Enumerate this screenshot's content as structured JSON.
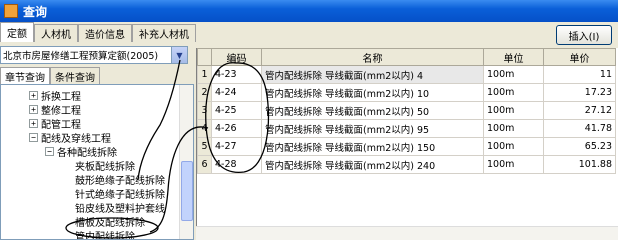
{
  "window": {
    "title": "查询"
  },
  "tabs": [
    {
      "label": "定额",
      "active": true
    },
    {
      "label": "人材机",
      "active": false
    },
    {
      "label": "造价信息",
      "active": false
    },
    {
      "label": "补充人材机",
      "active": false
    }
  ],
  "insert_button": {
    "label": "插入(I)"
  },
  "quota_select": {
    "value": "北京市房屋修缮工程预算定额(2005)"
  },
  "subtabs": [
    {
      "label": "章节查询",
      "active": true
    },
    {
      "label": "条件查询",
      "active": false
    }
  ],
  "tree": {
    "items": [
      {
        "label": "拆换工程",
        "toggle": "+"
      },
      {
        "label": "整修工程",
        "toggle": "+"
      },
      {
        "label": "配管工程",
        "toggle": "+"
      },
      {
        "label": "配线及穿线工程",
        "toggle": "−"
      },
      {
        "label": "各种配线拆除",
        "toggle": "−"
      },
      {
        "label": "夹板配线拆除",
        "toggle": ""
      },
      {
        "label": "鼓形绝缘子配线拆除",
        "toggle": ""
      },
      {
        "label": "针式绝缘子配线拆除",
        "toggle": ""
      },
      {
        "label": "铅皮线及塑料护套线",
        "toggle": ""
      },
      {
        "label": "槽板及配线拆除",
        "toggle": ""
      },
      {
        "label": "管内配线拆除",
        "toggle": ""
      }
    ]
  },
  "grid": {
    "headers": [
      "",
      "编码",
      "名称",
      "单位",
      "单价"
    ],
    "rows": [
      {
        "num": "1",
        "code": "4-23",
        "name": "管内配线拆除 导线截面(mm2以内) 4",
        "unit": "100m",
        "price": "11"
      },
      {
        "num": "2",
        "code": "4-24",
        "name": "管内配线拆除 导线截面(mm2以内) 10",
        "unit": "100m",
        "price": "17.23"
      },
      {
        "num": "3",
        "code": "4-25",
        "name": "管内配线拆除 导线截面(mm2以内) 50",
        "unit": "100m",
        "price": "27.12"
      },
      {
        "num": "4",
        "code": "4-26",
        "name": "管内配线拆除 导线截面(mm2以内) 95",
        "unit": "100m",
        "price": "41.78"
      },
      {
        "num": "5",
        "code": "4-27",
        "name": "管内配线拆除 导线截面(mm2以内) 150",
        "unit": "100m",
        "price": "65.23"
      },
      {
        "num": "6",
        "code": "4-28",
        "name": "管内配线拆除 导线截面(mm2以内) 240",
        "unit": "100m",
        "price": "101.88"
      }
    ]
  },
  "colors": {
    "titlebar": "#0a5fd8",
    "annotation": "#000000"
  }
}
